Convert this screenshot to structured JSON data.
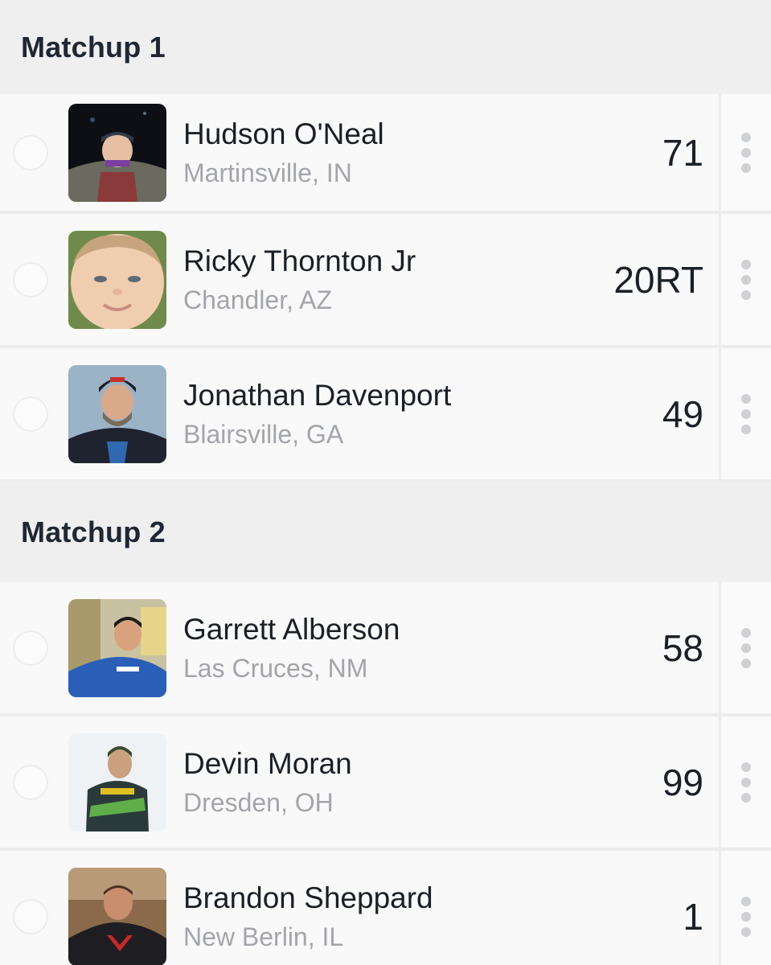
{
  "matchups": [
    {
      "title": "Matchup 1",
      "drivers": [
        {
          "name": "Hudson O'Neal",
          "location": "Martinsville, IN",
          "number": "71",
          "avatar_icon": "driver-photo"
        },
        {
          "name": "Ricky Thornton Jr",
          "location": "Chandler, AZ",
          "number": "20RT",
          "avatar_icon": "driver-photo"
        },
        {
          "name": "Jonathan Davenport",
          "location": "Blairsville, GA",
          "number": "49",
          "avatar_icon": "driver-photo"
        }
      ]
    },
    {
      "title": "Matchup 2",
      "drivers": [
        {
          "name": "Garrett Alberson",
          "location": "Las Cruces, NM",
          "number": "58",
          "avatar_icon": "driver-photo"
        },
        {
          "name": "Devin Moran",
          "location": "Dresden, OH",
          "number": "99",
          "avatar_icon": "driver-photo"
        },
        {
          "name": "Brandon Sheppard",
          "location": "New Berlin, IL",
          "number": "1",
          "avatar_icon": "driver-photo"
        }
      ]
    }
  ],
  "colors": {
    "header_bg": "#efeff0",
    "row_bg": "#f9f9f9",
    "title_text": "#1f2733",
    "secondary_text": "#a3a5aa"
  }
}
